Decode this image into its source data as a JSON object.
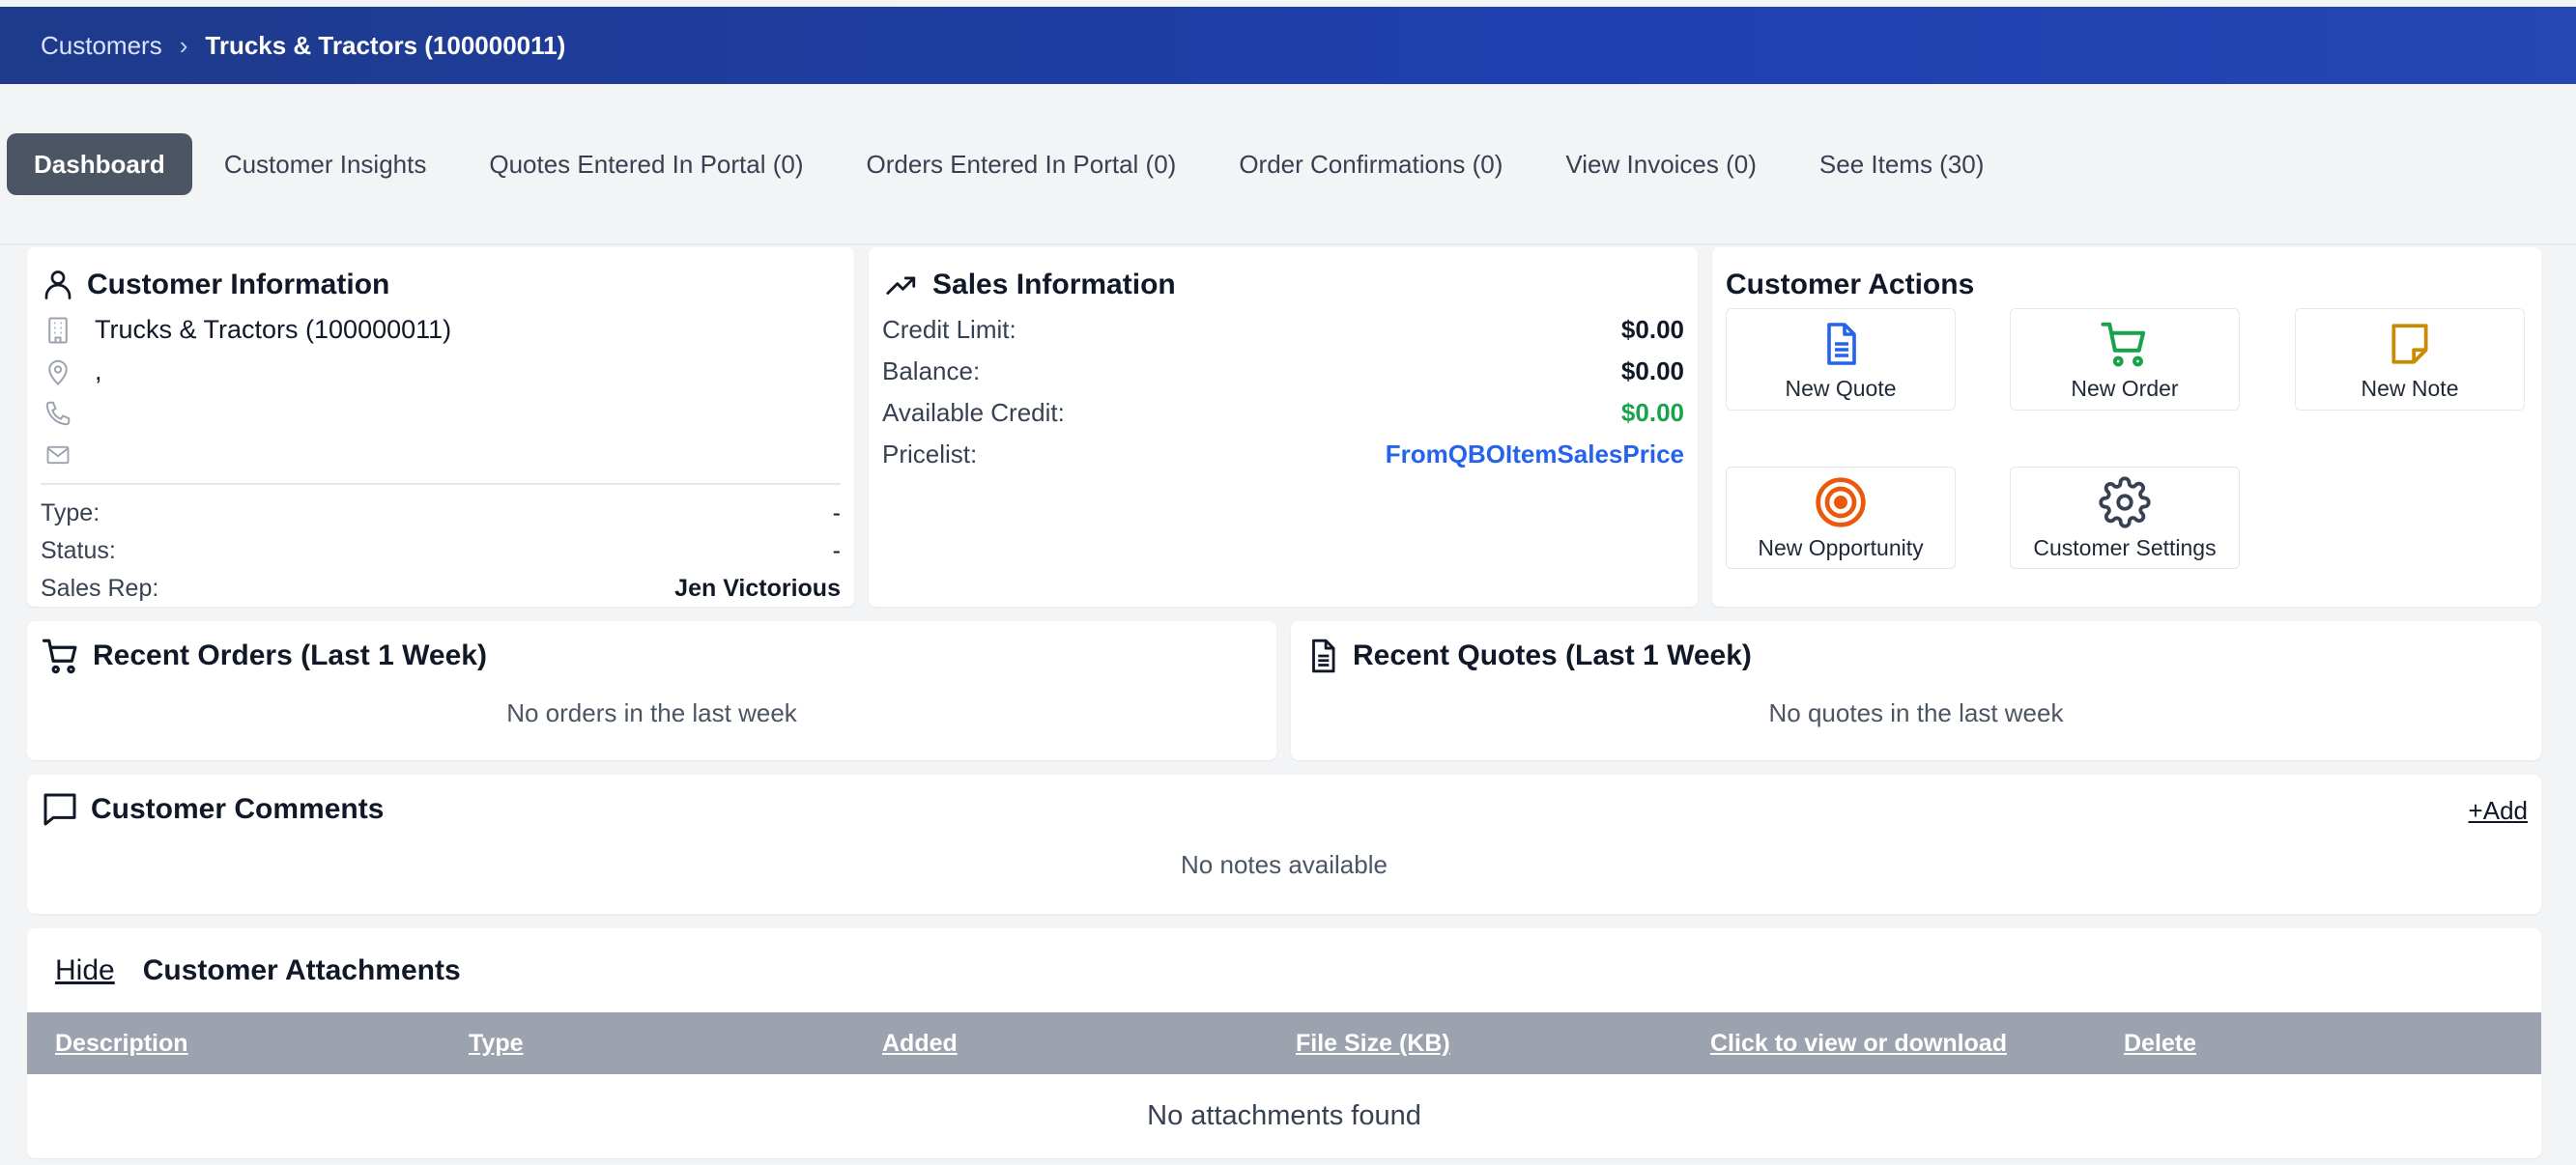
{
  "breadcrumb": {
    "root": "Customers",
    "separator": "›",
    "current": "Trucks & Tractors (100000011)"
  },
  "tabs": [
    {
      "label": "Dashboard",
      "active": true
    },
    {
      "label": "Customer Insights"
    },
    {
      "label": "Quotes Entered In Portal (0)"
    },
    {
      "label": "Orders Entered In Portal (0)"
    },
    {
      "label": "Order Confirmations (0)"
    },
    {
      "label": "View Invoices (0)"
    },
    {
      "label": "See Items (30)"
    }
  ],
  "customer_info": {
    "title": "Customer Information",
    "name": "Trucks & Tractors (100000011)",
    "address": ",",
    "phone": "",
    "email": "",
    "type_label": "Type:",
    "type_value": "-",
    "status_label": "Status:",
    "status_value": "-",
    "sales_rep_label": "Sales Rep:",
    "sales_rep_value": "Jen Victorious"
  },
  "sales_info": {
    "title": "Sales Information",
    "credit_limit_label": "Credit Limit:",
    "credit_limit_value": "$0.00",
    "balance_label": "Balance:",
    "balance_value": "$0.00",
    "available_credit_label": "Available Credit:",
    "available_credit_value": "$0.00",
    "pricelist_label": "Pricelist:",
    "pricelist_value": "FromQBOItemSalesPrice"
  },
  "customer_actions": {
    "title": "Customer Actions",
    "new_quote": "New Quote",
    "new_order": "New Order",
    "new_note": "New Note",
    "new_opportunity": "New Opportunity",
    "customer_settings": "Customer Settings"
  },
  "recent_orders": {
    "title": "Recent Orders (Last 1 Week)",
    "empty": "No orders in the last week"
  },
  "recent_quotes": {
    "title": "Recent Quotes (Last 1 Week)",
    "empty": "No quotes in the last week"
  },
  "comments": {
    "title": "Customer Comments",
    "add_label": "+Add",
    "empty": "No notes available"
  },
  "attachments": {
    "hide_label": "Hide",
    "title": "Customer Attachments",
    "columns": [
      "Description",
      "Type",
      "Added",
      "File Size (KB)",
      "Click to view or download",
      "Delete"
    ],
    "empty": "No attachments found"
  },
  "colors": {
    "header_blue": "#1e40af",
    "active_tab": "#4b5563",
    "green": "#16a34a",
    "link_blue": "#2563eb",
    "orange": "#ea580c",
    "note_amber": "#ca8a04",
    "table_header": "#9ca3af"
  }
}
